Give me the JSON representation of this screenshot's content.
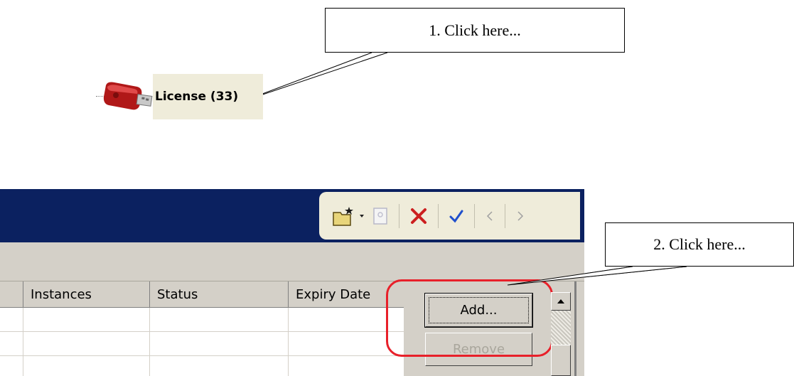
{
  "callouts": {
    "step1": "1. Click here...",
    "step2": "2. Click here..."
  },
  "tree": {
    "node_label": "License (33)",
    "node_icon": "usb-key-icon"
  },
  "toolbar": {
    "icons": [
      "new-folder-icon",
      "dropdown-arrow-icon",
      "disabled-item-icon",
      "delete-icon",
      "confirm-icon",
      "previous-icon",
      "next-icon"
    ]
  },
  "grid": {
    "columns": [
      "Instances",
      "Status",
      "Expiry Date"
    ],
    "rows": [
      [
        "",
        "",
        ""
      ],
      [
        "",
        "",
        ""
      ],
      [
        "",
        "",
        ""
      ]
    ]
  },
  "buttons": {
    "add": "Add...",
    "remove": "Remove"
  },
  "colors": {
    "titlebar": "#0b2160",
    "highlight": "#e8202a",
    "node_background": "#efecda",
    "delete": "#cc1f1f",
    "confirm": "#1f4fcc"
  }
}
